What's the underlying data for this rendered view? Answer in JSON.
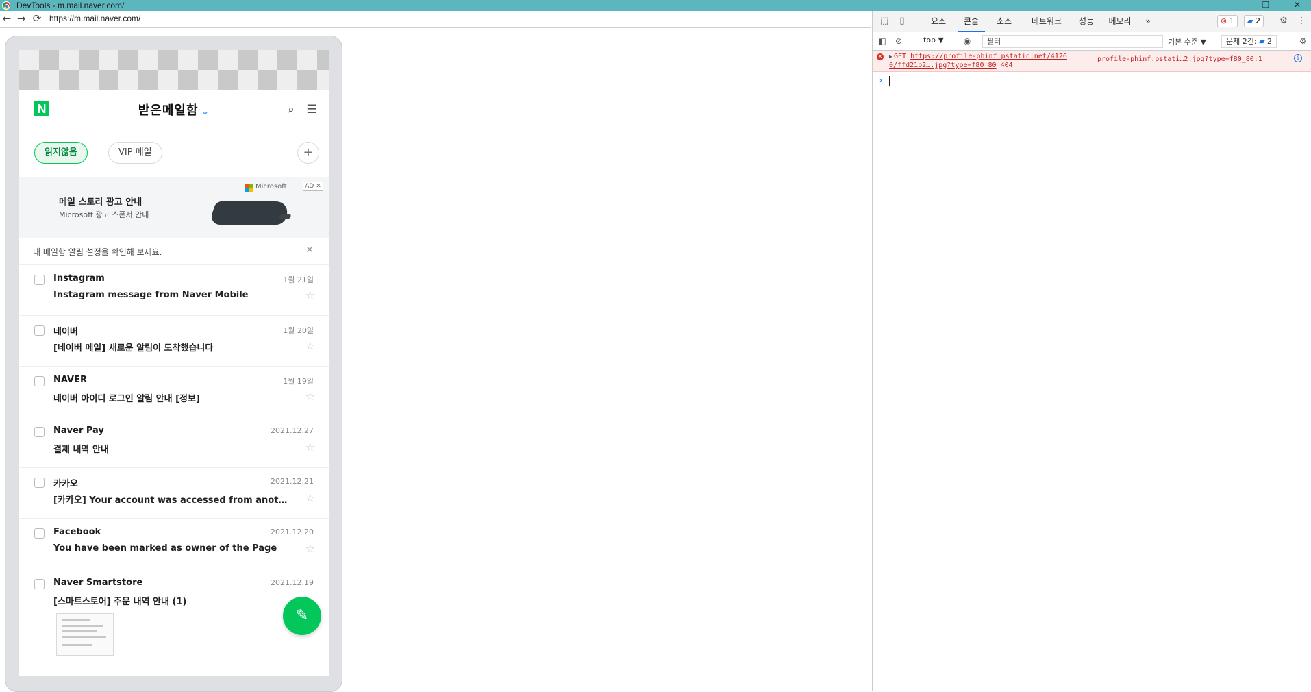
{
  "window": {
    "title": "DevTools - m.mail.naver.com/",
    "min_glyph": "—",
    "restore_glyph": "❐",
    "close_glyph": "✕"
  },
  "browser": {
    "back_glyph": "←",
    "forward_glyph": "→",
    "reload_glyph": "⟳",
    "url": "https://m.mail.naver.com/"
  },
  "app": {
    "logo": "N",
    "title": "받은메일함",
    "title_chevron": "⌄",
    "search_glyph": "⌕",
    "menu_glyph": "☰",
    "chips": [
      {
        "label": "읽지않음"
      },
      {
        "label": "VIP 메일"
      }
    ],
    "chip_add_glyph": "+",
    "banner": {
      "headline": "메일 스토리 광고 안내",
      "subline": "Microsoft 광고 스폰서 안내",
      "brand": "Microsoft",
      "ad_close": "AD ✕"
    },
    "notice": {
      "text": "내 메일함 알림 설정을 확인해 보세요.",
      "close": "✕"
    },
    "mails": [
      {
        "sender": "Instagram",
        "date": "1월 21일",
        "subject": "Instagram message from Naver Mobile"
      },
      {
        "sender": "네이버",
        "date": "1월 20일",
        "subject": "[네이버 메일] 새로운 알림이 도착했습니다"
      },
      {
        "sender": "NAVER",
        "date": "1월 19일",
        "subject": "네이버 아이디 로그인 알림 안내 [정보]"
      },
      {
        "sender": "Naver Pay",
        "date": "2021.12.27",
        "subject": "결제 내역 안내"
      },
      {
        "sender": "카카오",
        "date": "2021.12.21",
        "subject": "[카카오] Your account was accessed from another location"
      },
      {
        "sender": "Facebook",
        "date": "2021.12.20",
        "subject": "You have been marked as owner of the Page"
      },
      {
        "sender": "Naver Smartstore",
        "date": "2021.12.19",
        "subject": "[스마트스토어] 주문 내역 안내 (1)"
      }
    ],
    "star_glyph": "☆",
    "fab_glyph": "✎"
  },
  "devtools": {
    "tabs": [
      "요소",
      "콘솔",
      "소스",
      "네트워크",
      "성능",
      "메모리"
    ],
    "active_tab": "콘솔",
    "more_glyph": "»",
    "error_count": "1",
    "message_count": "2",
    "context": "top ▼",
    "filter_placeholder": "필터",
    "level": "기본 수준 ▼",
    "issues_label": "문제 2건:",
    "issues_count": "2",
    "console_error": {
      "method": "GET",
      "url_part1": "https://profile-phinf.pstatic.net/4126",
      "url_part2": "0/ffd21b2….jpg?type=f80_80",
      "status": "404",
      "source": "profile-phinf.pstati…2.jpg?type=f80_80:1"
    },
    "prompt": "›"
  },
  "colors": {
    "titlebar": "#5bb6bd",
    "naver_green": "#03c75a",
    "devtools_accent": "#1a73e8",
    "error_red": "#d93025"
  }
}
